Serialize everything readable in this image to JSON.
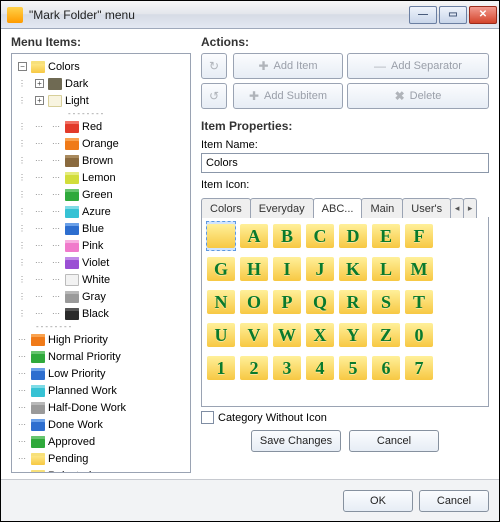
{
  "window": {
    "title": "\"Mark Folder\" menu",
    "minimize_tip": "Minimize",
    "maximize_tip": "Maximize",
    "close_tip": "Close"
  },
  "left": {
    "heading": "Menu Items:"
  },
  "tree": {
    "root": {
      "label": "Colors",
      "expanded": true
    },
    "dark_label": "Dark",
    "light_label": "Light",
    "colors": [
      {
        "k": "red",
        "label": "Red"
      },
      {
        "k": "orange",
        "label": "Orange"
      },
      {
        "k": "brown",
        "label": "Brown"
      },
      {
        "k": "lemon",
        "label": "Lemon"
      },
      {
        "k": "green",
        "label": "Green"
      },
      {
        "k": "azure",
        "label": "Azure"
      },
      {
        "k": "blue",
        "label": "Blue"
      },
      {
        "k": "pink",
        "label": "Pink"
      },
      {
        "k": "violet",
        "label": "Violet"
      },
      {
        "k": "white",
        "label": "White"
      },
      {
        "k": "gray",
        "label": "Gray"
      },
      {
        "k": "black",
        "label": "Black"
      }
    ],
    "extras": [
      {
        "k": "orange",
        "label": "High Priority"
      },
      {
        "k": "green",
        "label": "Normal Priority"
      },
      {
        "k": "blue",
        "label": "Low Priority"
      },
      {
        "k": "azure",
        "label": "Planned Work"
      },
      {
        "k": "gray",
        "label": "Half-Done Work"
      },
      {
        "k": "blue",
        "label": "Done Work"
      },
      {
        "k": "green",
        "label": "Approved"
      },
      {
        "k": "",
        "label": "Pending"
      },
      {
        "k": "",
        "label": "Rejected"
      }
    ],
    "sep": "--------"
  },
  "actions": {
    "heading": "Actions:",
    "up_tip": "Move Up",
    "down_tip": "Move Down",
    "add_item": "Add Item",
    "add_subitem": "Add Subitem",
    "add_separator": "Add Separator",
    "delete": "Delete"
  },
  "props": {
    "heading": "Item Properties:",
    "name_label": "Item Name:",
    "name_value": "Colors",
    "icon_label": "Item Icon:",
    "tabs": {
      "colors": "Colors",
      "everyday": "Everyday",
      "abc": "ABC...",
      "main": "Main",
      "users": "User's",
      "left": "◂",
      "right": "▸"
    },
    "grid": [
      "",
      "A",
      "B",
      "C",
      "D",
      "E",
      "F",
      "G",
      "H",
      "I",
      "J",
      "K",
      "L",
      "M",
      "N",
      "O",
      "P",
      "Q",
      "R",
      "S",
      "T",
      "U",
      "V",
      "W",
      "X",
      "Y",
      "Z",
      "0",
      "1",
      "2",
      "3",
      "4",
      "5",
      "6",
      "7"
    ],
    "category_without_icon": "Category Without Icon",
    "save_changes": "Save Changes",
    "cancel": "Cancel"
  },
  "footer": {
    "ok": "OK",
    "cancel": "Cancel"
  }
}
